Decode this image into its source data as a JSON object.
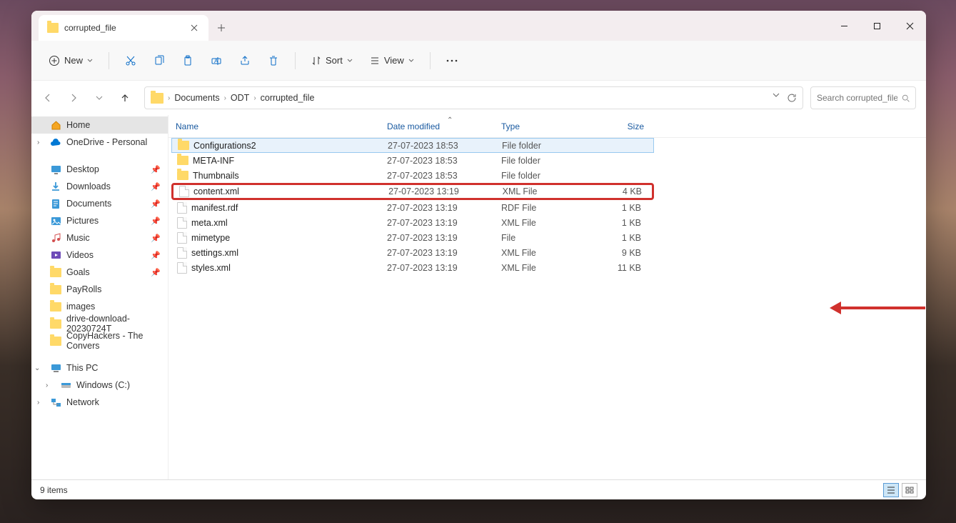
{
  "tab": {
    "title": "corrupted_file"
  },
  "toolbar": {
    "new_label": "New",
    "sort_label": "Sort",
    "view_label": "View"
  },
  "breadcrumbs": [
    "Documents",
    "ODT",
    "corrupted_file"
  ],
  "search": {
    "placeholder": "Search corrupted_file"
  },
  "columns": {
    "name": "Name",
    "date": "Date modified",
    "type": "Type",
    "size": "Size"
  },
  "sidebar": {
    "home": "Home",
    "onedrive": "OneDrive - Personal",
    "desktop": "Desktop",
    "downloads": "Downloads",
    "documents": "Documents",
    "pictures": "Pictures",
    "music": "Music",
    "videos": "Videos",
    "goals": "Goals",
    "payrolls": "PayRolls",
    "images": "images",
    "drive_dl": "drive-download-20230724T",
    "copyhackers": "CopyHackers - The Convers",
    "thispc": "This PC",
    "windowsc": "Windows (C:)",
    "network": "Network"
  },
  "files": [
    {
      "name": "Configurations2",
      "date": "27-07-2023 18:53",
      "type": "File folder",
      "size": "",
      "kind": "folder",
      "state": "sel"
    },
    {
      "name": "META-INF",
      "date": "27-07-2023 18:53",
      "type": "File folder",
      "size": "",
      "kind": "folder",
      "state": ""
    },
    {
      "name": "Thumbnails",
      "date": "27-07-2023 18:53",
      "type": "File folder",
      "size": "",
      "kind": "folder",
      "state": ""
    },
    {
      "name": "content.xml",
      "date": "27-07-2023 13:19",
      "type": "XML File",
      "size": "4 KB",
      "kind": "file",
      "state": "hl"
    },
    {
      "name": "manifest.rdf",
      "date": "27-07-2023 13:19",
      "type": "RDF File",
      "size": "1 KB",
      "kind": "file",
      "state": ""
    },
    {
      "name": "meta.xml",
      "date": "27-07-2023 13:19",
      "type": "XML File",
      "size": "1 KB",
      "kind": "file",
      "state": ""
    },
    {
      "name": "mimetype",
      "date": "27-07-2023 13:19",
      "type": "File",
      "size": "1 KB",
      "kind": "file",
      "state": ""
    },
    {
      "name": "settings.xml",
      "date": "27-07-2023 13:19",
      "type": "XML File",
      "size": "9 KB",
      "kind": "file",
      "state": ""
    },
    {
      "name": "styles.xml",
      "date": "27-07-2023 13:19",
      "type": "XML File",
      "size": "11 KB",
      "kind": "file",
      "state": ""
    }
  ],
  "status": {
    "count": "9 items"
  }
}
